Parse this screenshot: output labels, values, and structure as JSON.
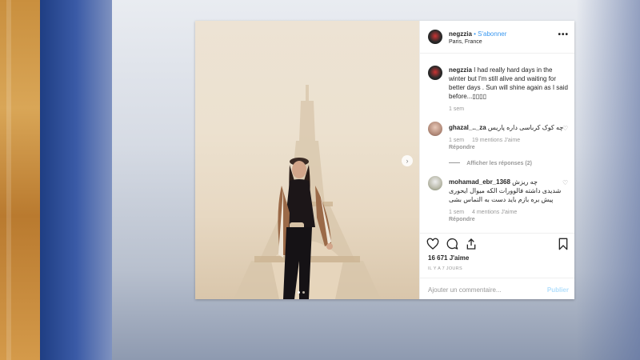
{
  "post": {
    "username": "negzzia",
    "follow_label": "• S'abonner",
    "location": "Paris, France",
    "caption_user": "negzzia",
    "caption_text": " I had really hard days in the winter but I'm still alive and waiting for better days . Sun will shine again as I said before...",
    "caption_emoji": "▯▯▯▯",
    "caption_time": "1 sem",
    "more_label": "•••"
  },
  "comments": [
    {
      "username": "ghazal_.._za",
      "text": "چه کوک کرباسی داره پاریس",
      "time": "1 sem",
      "likes": "19 mentions J'aime",
      "reply": "Répondre"
    },
    {
      "username": "mohamad_ebr_1368",
      "text_line1": "چه ریزش",
      "text_line2": "شدیدی داشته فالوورات الکه میوال ایحوری",
      "text_line3": "پیش بره بازم باید دست به التماس بشی",
      "time": "1 sem",
      "likes": "4 mentions J'aime",
      "reply": "Répondre"
    }
  ],
  "view_replies": "Afficher les réponses (2)",
  "likes_count": "16 671 J'aime",
  "posted_ago": "IL Y A 7 JOURS",
  "add_comment_placeholder": "Ajouter un commentaire...",
  "publish_label": "Publier",
  "next_arrow": "›",
  "colors": {
    "link": "#3897f0",
    "publish": "#b2dffc",
    "muted": "#999999"
  }
}
